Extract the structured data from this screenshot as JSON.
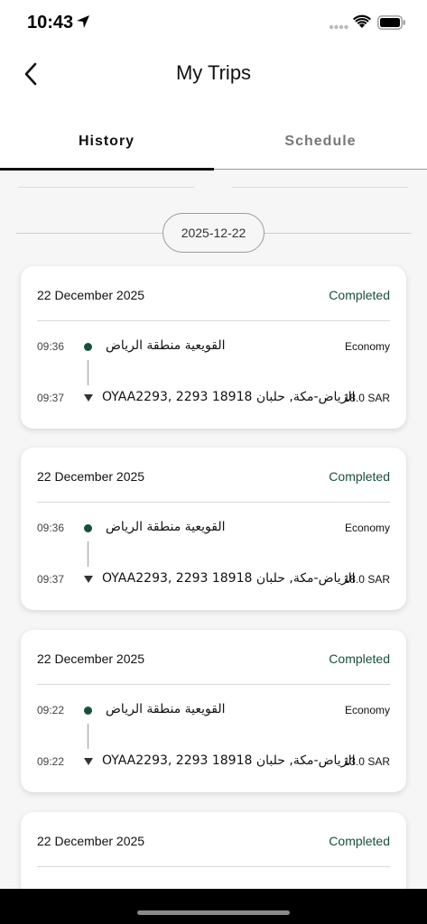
{
  "status_bar": {
    "time": "10:43"
  },
  "header": {
    "title": "My Trips"
  },
  "tabs": [
    {
      "label": "History"
    },
    {
      "label": "Schedule"
    }
  ],
  "date_group": {
    "date": "2025-12-22"
  },
  "trips": [
    {
      "date": "22 December 2025",
      "status": "Completed",
      "from_time": "09:36",
      "from_location": "القويعية منطقة الرياض",
      "to_time": "09:37",
      "to_location": "OYAA2293, 2293 18918 الرياض-مكة, حلبان",
      "vehicle_class": "Economy",
      "fare": "18.0 SAR"
    },
    {
      "date": "22 December 2025",
      "status": "Completed",
      "from_time": "09:36",
      "from_location": "القويعية منطقة الرياض",
      "to_time": "09:37",
      "to_location": "OYAA2293, 2293 18918 الرياض-مكة, حلبان",
      "vehicle_class": "Economy",
      "fare": "18.0 SAR"
    },
    {
      "date": "22 December 2025",
      "status": "Completed",
      "from_time": "09:22",
      "from_location": "القويعية منطقة الرياض",
      "to_time": "09:22",
      "to_location": "OYAA2293, 2293 18918 الرياض-مكة, حلبان",
      "vehicle_class": "Economy",
      "fare": "13.0 SAR"
    },
    {
      "date": "22 December 2025",
      "status": "Completed"
    }
  ],
  "colors": {
    "accent_green": "#17503f",
    "tab_active": "#111111",
    "tab_inactive": "#777777"
  },
  "icons": {
    "back": "chevron-left-icon",
    "location_arrow": "location-arrow-icon",
    "wifi": "wifi-icon",
    "battery": "battery-icon"
  }
}
